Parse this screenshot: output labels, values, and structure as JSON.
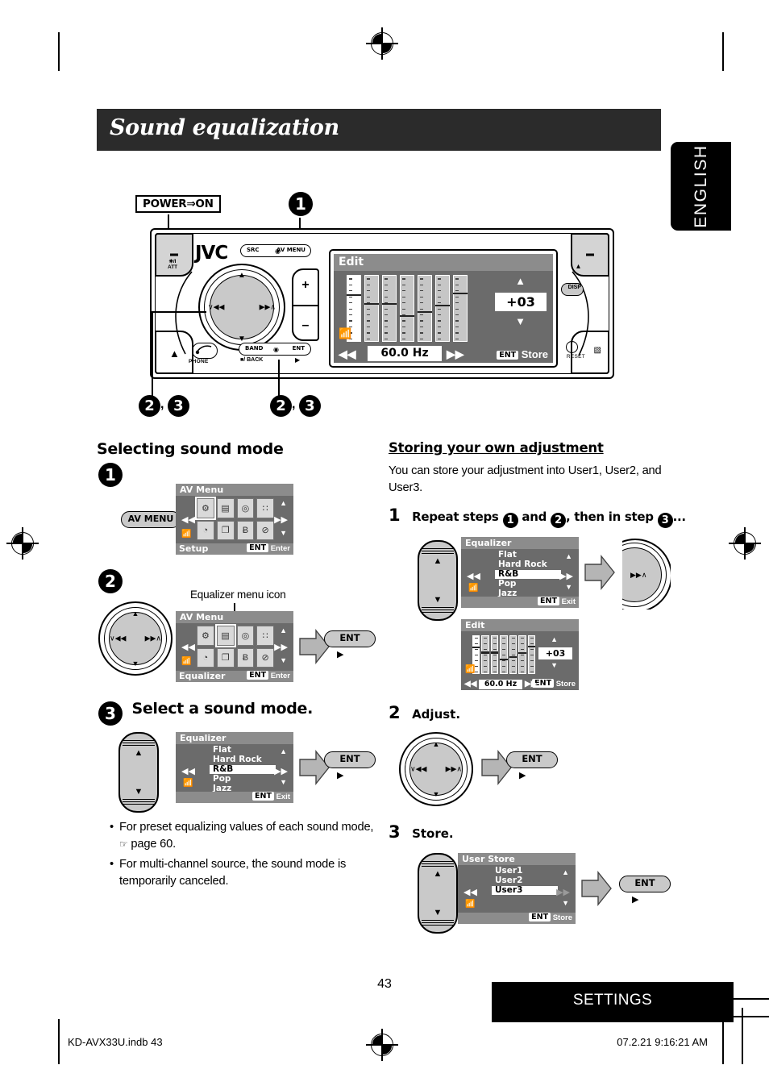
{
  "document": {
    "title": "Sound equalization",
    "language_tab": "ENGLISH",
    "page_number": "43",
    "footer_bar": "SETTINGS",
    "footer_left": "KD-AVX33U.indb   43",
    "footer_right": "07.2.21   9:16:21 AM"
  },
  "unit_diagram": {
    "power_callout": "POWER⇒ON",
    "brand": "JVC",
    "step_callout_top": "1",
    "step_callouts_bottom": [
      "2",
      "3",
      "2",
      "3"
    ],
    "buttons": {
      "src": "SRC",
      "av_menu": "AV MENU",
      "band": "BAND",
      "ent": "ENT",
      "back": "/ BACK",
      "phone": "PHONE",
      "disp": "DISP",
      "reset": "RESET",
      "power_att": "ATT"
    },
    "display": {
      "title": "Edit",
      "value": "+03",
      "frequency": "60.0 Hz",
      "ent_chip": "ENT",
      "store_label": "Store",
      "band_count": 7,
      "band_levels": [
        0.28,
        0.42,
        0.42,
        0.6,
        0.54,
        0.44,
        0.26
      ],
      "selected_band_index": 0
    }
  },
  "left_column": {
    "section_title": "Selecting sound mode",
    "step1": {
      "number": "1",
      "button_label": "AV MENU",
      "panel": {
        "title": "AV Menu",
        "footer_left": "Setup",
        "footer_ent": "ENT",
        "footer_right": "Enter",
        "highlighted_index": 0
      }
    },
    "step2": {
      "number": "2",
      "annotation": "Equalizer menu icon",
      "panel": {
        "title": "AV Menu",
        "footer_left": "Equalizer",
        "footer_ent": "ENT",
        "footer_right": "Enter",
        "highlighted_index": 1
      },
      "result_button": "ENT"
    },
    "step3": {
      "number": "3",
      "instruction": "Select a sound mode.",
      "panel": {
        "title": "Equalizer",
        "items": [
          "Flat",
          "Hard Rock",
          "R&B",
          "Pop",
          "Jazz"
        ],
        "selected": "R&B",
        "footer_ent": "ENT",
        "footer_right": "Exit"
      },
      "result_button": "ENT"
    },
    "notes": [
      "For preset equalizing values of each sound mode,",
      "page 60.",
      "For multi-channel source, the sound mode is",
      "temporarily canceled."
    ]
  },
  "right_column": {
    "section_title": "Storing your own adjustment",
    "intro_line1": "You can store your adjustment into User1, User2, and",
    "intro_line2": "User3.",
    "step1": {
      "number": "1",
      "text_a": "Repeat steps ",
      "text_b": " and ",
      "text_c": ", then in step ",
      "text_d": "...",
      "badge_a": "1",
      "badge_b": "2",
      "badge_c": "3",
      "equalizer_panel": {
        "title": "Equalizer",
        "items": [
          "Flat",
          "Hard Rock",
          "R&B",
          "Pop",
          "Jazz"
        ],
        "selected": "R&B",
        "footer_ent": "ENT",
        "footer_right": "Exit"
      },
      "edit_panel": {
        "title": "Edit",
        "value": "+03",
        "frequency": "60.0 Hz",
        "footer_ent": "ENT",
        "footer_right": "Store",
        "band_levels": [
          0.28,
          0.42,
          0.42,
          0.6,
          0.54,
          0.44,
          0.26
        ]
      }
    },
    "step2": {
      "number": "2",
      "instruction": "Adjust.",
      "result_button": "ENT"
    },
    "step3": {
      "number": "3",
      "instruction": "Store.",
      "panel": {
        "title": "User Store",
        "items": [
          "User1",
          "User2",
          "User3"
        ],
        "selected": "User3",
        "footer_ent": "ENT",
        "footer_right": "Store"
      },
      "result_button": "ENT"
    }
  },
  "colors": {
    "title_bar": "#2b2b2b",
    "lcd_bg": "#6b6b6b",
    "lcd_header": "#8c8c8c",
    "button_grey": "#c9c9c9",
    "arrow_grey": "#b5b5b5"
  }
}
